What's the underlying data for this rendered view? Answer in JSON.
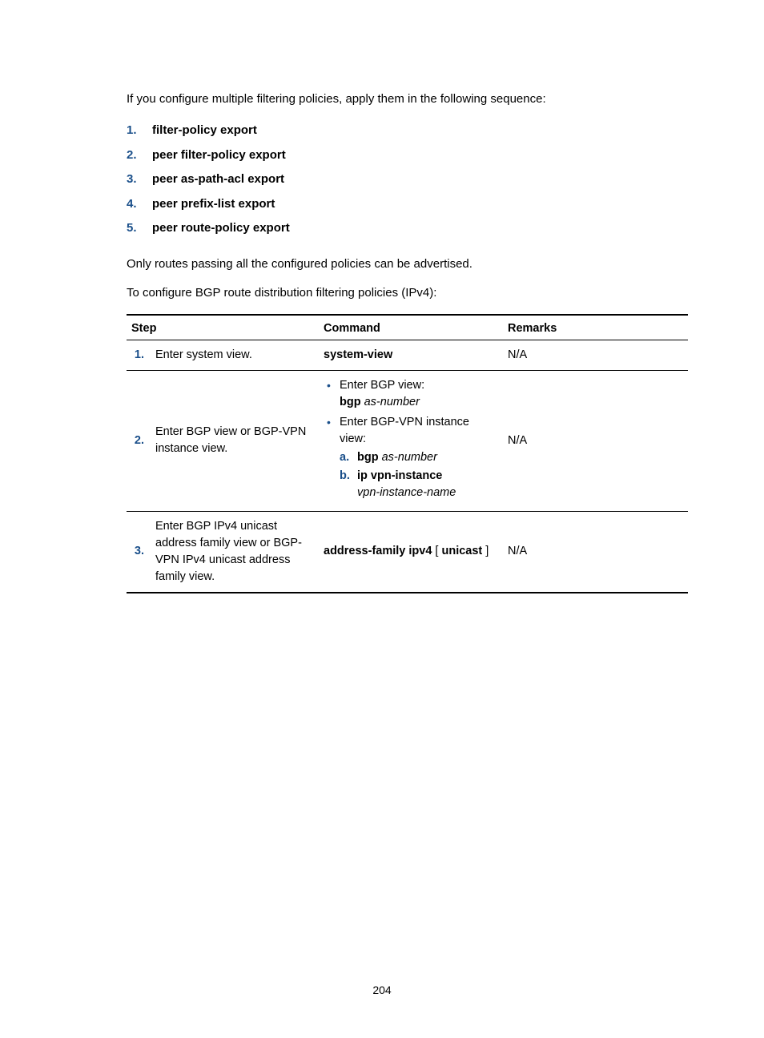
{
  "intro": "If you configure multiple filtering policies, apply them in the following sequence:",
  "policy_list": [
    "filter-policy export",
    "peer filter-policy export",
    "peer as-path-acl export",
    "peer prefix-list export",
    "peer route-policy export"
  ],
  "para1": "Only routes passing all the configured policies can be advertised.",
  "para2": "To configure BGP route distribution filtering policies (IPv4):",
  "table": {
    "headers": {
      "step": "Step",
      "command": "Command",
      "remarks": "Remarks"
    },
    "rows": {
      "r1": {
        "num": "1.",
        "step": "Enter system view.",
        "cmd_bold": "system-view",
        "remarks": "N/A"
      },
      "r2": {
        "num": "2.",
        "step": "Enter BGP view or BGP-VPN instance view.",
        "b1_text": "Enter BGP view:",
        "b1_cmd_bold": "bgp",
        "b1_cmd_italic": "as-number",
        "b2_text": "Enter BGP-VPN instance view:",
        "b2a_marker": "a.",
        "b2a_bold": "bgp",
        "b2a_italic": "as-number",
        "b2b_marker": "b.",
        "b2b_bold": "ip vpn-instance",
        "b2b_italic": "vpn-instance-name",
        "remarks": "N/A"
      },
      "r3": {
        "num": "3.",
        "step": "Enter BGP IPv4 unicast address family view or BGP-VPN IPv4 unicast address family view.",
        "cmd_pre_bold": "address-family ipv4",
        "cmd_bracket_open": " [ ",
        "cmd_mid_bold": "unicast",
        "cmd_bracket_close": " ]",
        "remarks": "N/A"
      }
    }
  },
  "page_number": "204"
}
